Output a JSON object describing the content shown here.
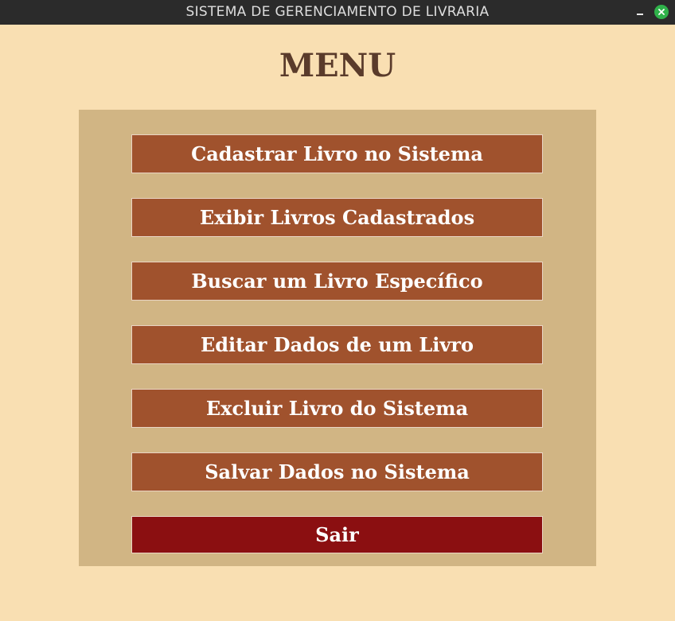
{
  "window": {
    "title": "SISTEMA DE GERENCIAMENTO DE LIVRARIA"
  },
  "page": {
    "title": "MENU"
  },
  "menu": {
    "items": [
      {
        "label": "Cadastrar Livro no Sistema"
      },
      {
        "label": "Exibir Livros Cadastrados"
      },
      {
        "label": "Buscar um Livro Específico"
      },
      {
        "label": "Editar Dados de um Livro"
      },
      {
        "label": "Excluir Livro do Sistema"
      },
      {
        "label": "Salvar Dados no Sistema"
      },
      {
        "label": "Sair"
      }
    ]
  },
  "colors": {
    "background": "#f9dfb2",
    "panel": "#d1b584",
    "button": "#a0522d",
    "exit_button": "#8b0f11",
    "title_text": "#5a3b2b",
    "titlebar": "#2b2b2b",
    "close_icon": "#2fb24a"
  },
  "icons": {
    "minimize": "minimize-icon",
    "close": "close-icon"
  }
}
